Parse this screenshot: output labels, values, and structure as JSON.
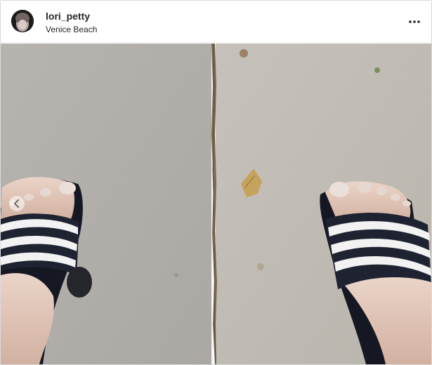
{
  "post": {
    "username": "lori_petty",
    "location": "Venice Beach",
    "more_icon": "more-horizontal-icon",
    "prev_icon": "chevron-left-icon",
    "photo_subject": "feet in black and white striped slide sandals on a concrete sidewalk"
  },
  "colors": {
    "text": "#262626",
    "border": "#dbdbdb",
    "concrete": "#bcb8b1",
    "sandal": "#1e2230"
  }
}
